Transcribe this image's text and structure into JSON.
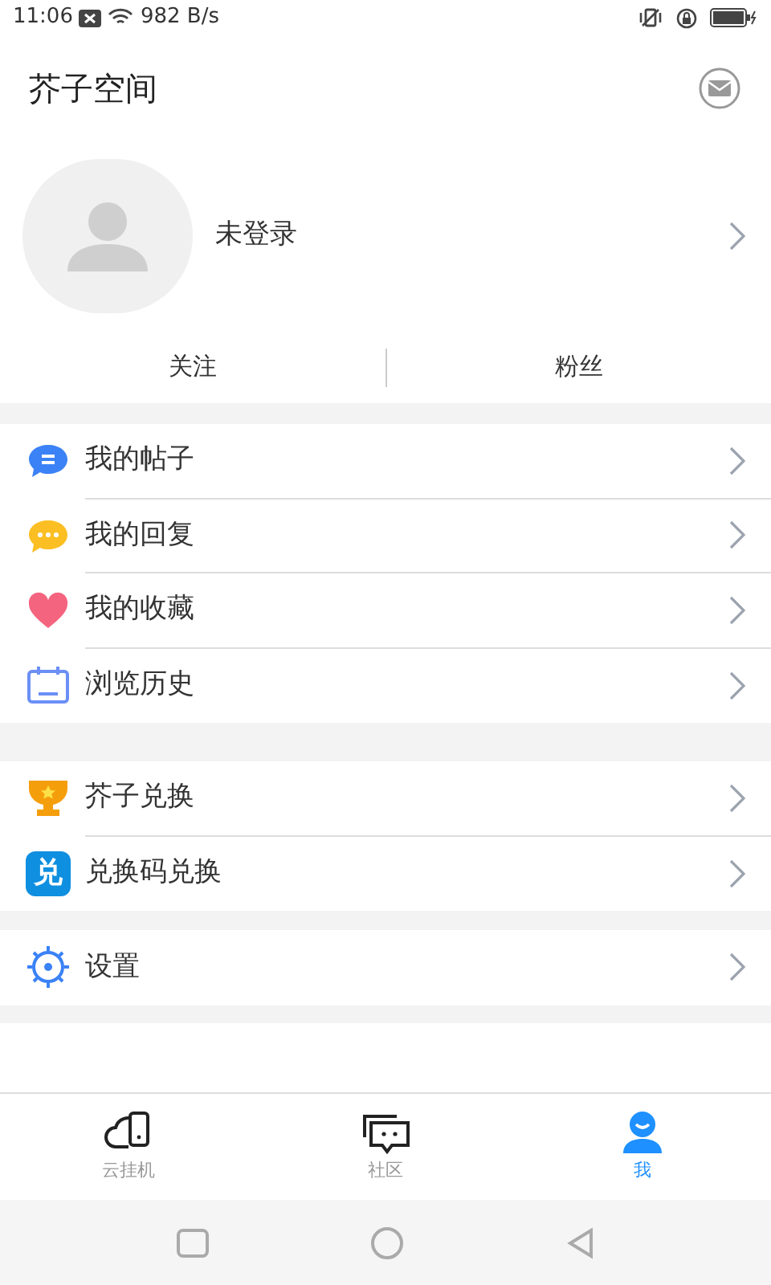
{
  "status_bar": {
    "time": "11:06",
    "speed": "982 B/s"
  },
  "header": {
    "title": "芥子空间"
  },
  "profile": {
    "name": "未登录"
  },
  "follow": [
    "关注",
    "粉丝"
  ],
  "groups": [
    [
      {
        "kind": "posts",
        "label": "我的帖子"
      },
      {
        "kind": "replies",
        "label": "我的回复"
      },
      {
        "kind": "favorites",
        "label": "我的收藏"
      },
      {
        "kind": "history",
        "label": "浏览历史"
      }
    ],
    [
      {
        "kind": "trophy",
        "label": "芥子兑换"
      },
      {
        "kind": "code",
        "label": "兑换码兑换",
        "badge": "兑"
      }
    ],
    [
      {
        "kind": "settings",
        "label": "设置"
      }
    ]
  ],
  "bottom_nav": [
    {
      "kind": "cloud",
      "label": "云挂机",
      "selected": false
    },
    {
      "kind": "chat",
      "label": "社区",
      "selected": false
    },
    {
      "kind": "user",
      "label": "我",
      "selected": true
    }
  ]
}
